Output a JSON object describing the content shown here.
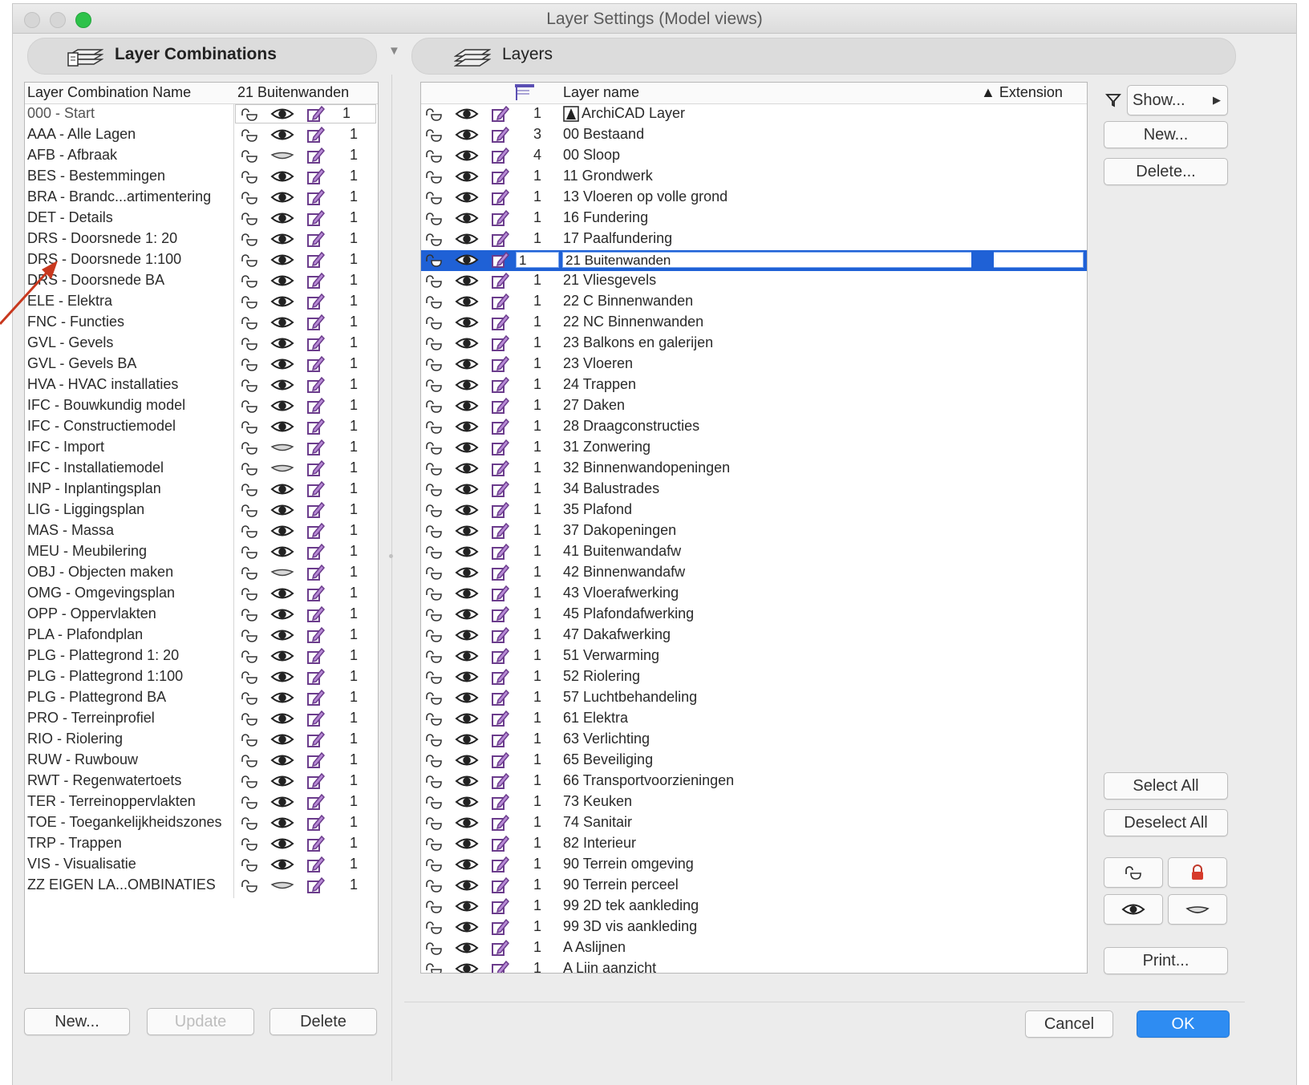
{
  "window": {
    "title": "Layer Settings (Model views)"
  },
  "combos": {
    "header": "Layer Combinations",
    "col_name": "Layer Combination Name",
    "col_selected": "21 Buitenwanden",
    "rows": [
      {
        "name": "000 - Start",
        "num": "1",
        "vis": true
      },
      {
        "name": "AAA - Alle Lagen",
        "num": "1",
        "vis": true
      },
      {
        "name": "AFB - Afbraak",
        "num": "1",
        "vis": false
      },
      {
        "name": "BES - Bestemmingen",
        "num": "1",
        "vis": true
      },
      {
        "name": "BRA - Brandc...artimentering",
        "num": "1",
        "vis": true
      },
      {
        "name": "DET - Details",
        "num": "1",
        "vis": true
      },
      {
        "name": "DRS - Doorsnede 1: 20",
        "num": "1",
        "vis": true
      },
      {
        "name": "DRS - Doorsnede 1:100",
        "num": "1",
        "vis": true
      },
      {
        "name": "DRS - Doorsnede BA",
        "num": "1",
        "vis": true
      },
      {
        "name": "ELE - Elektra",
        "num": "1",
        "vis": true
      },
      {
        "name": "FNC - Functies",
        "num": "1",
        "vis": true
      },
      {
        "name": "GVL - Gevels",
        "num": "1",
        "vis": true
      },
      {
        "name": "GVL - Gevels BA",
        "num": "1",
        "vis": true
      },
      {
        "name": "HVA - HVAC installaties",
        "num": "1",
        "vis": true
      },
      {
        "name": "IFC - Bouwkundig model",
        "num": "1",
        "vis": true
      },
      {
        "name": "IFC - Constructiemodel",
        "num": "1",
        "vis": true
      },
      {
        "name": "IFC - Import",
        "num": "1",
        "vis": false
      },
      {
        "name": "IFC - Installatiemodel",
        "num": "1",
        "vis": false
      },
      {
        "name": "INP - Inplantingsplan",
        "num": "1",
        "vis": true
      },
      {
        "name": "LIG - Liggingsplan",
        "num": "1",
        "vis": true
      },
      {
        "name": "MAS - Massa",
        "num": "1",
        "vis": true
      },
      {
        "name": "MEU - Meubilering",
        "num": "1",
        "vis": true
      },
      {
        "name": "OBJ - Objecten maken",
        "num": "1",
        "vis": false
      },
      {
        "name": "OMG - Omgevingsplan",
        "num": "1",
        "vis": true
      },
      {
        "name": "OPP - Oppervlakten",
        "num": "1",
        "vis": true
      },
      {
        "name": "PLA - Plafondplan",
        "num": "1",
        "vis": true
      },
      {
        "name": "PLG - Plattegrond 1: 20",
        "num": "1",
        "vis": true
      },
      {
        "name": "PLG - Plattegrond 1:100",
        "num": "1",
        "vis": true
      },
      {
        "name": "PLG - Plattegrond BA",
        "num": "1",
        "vis": true
      },
      {
        "name": "PRO - Terreinprofiel",
        "num": "1",
        "vis": true
      },
      {
        "name": "RIO - Riolering",
        "num": "1",
        "vis": true
      },
      {
        "name": "RUW - Ruwbouw",
        "num": "1",
        "vis": true
      },
      {
        "name": "RWT - Regenwatertoets",
        "num": "1",
        "vis": true
      },
      {
        "name": "TER - Terreinoppervlakten",
        "num": "1",
        "vis": true
      },
      {
        "name": "TOE - Toegankelijkheidszones",
        "num": "1",
        "vis": true
      },
      {
        "name": "TRP - Trappen",
        "num": "1",
        "vis": true
      },
      {
        "name": "VIS - Visualisatie",
        "num": "1",
        "vis": true
      },
      {
        "name": "ZZ EIGEN LA...OMBINATIES",
        "num": "1",
        "vis": false
      }
    ],
    "buttons": {
      "new": "New...",
      "update": "Update",
      "delete": "Delete"
    }
  },
  "layers": {
    "header": "Layers",
    "col_name": "Layer name",
    "col_ext": "▲ Extension",
    "rows": [
      {
        "num": "1",
        "name": "ArchiCAD Layer",
        "lock": true
      },
      {
        "num": "3",
        "name": "00 Bestaand"
      },
      {
        "num": "4",
        "name": "00 Sloop"
      },
      {
        "num": "1",
        "name": "11 Grondwerk"
      },
      {
        "num": "1",
        "name": "13 Vloeren op volle grond"
      },
      {
        "num": "1",
        "name": "16 Fundering"
      },
      {
        "num": "1",
        "name": "17 Paalfundering"
      },
      {
        "num": "1",
        "name": "21 Buitenwanden",
        "selected": true
      },
      {
        "num": "1",
        "name": "21 Vliesgevels"
      },
      {
        "num": "1",
        "name": "22 C Binnenwanden"
      },
      {
        "num": "1",
        "name": "22 NC Binnenwanden"
      },
      {
        "num": "1",
        "name": "23 Balkons en galerijen"
      },
      {
        "num": "1",
        "name": "23 Vloeren"
      },
      {
        "num": "1",
        "name": "24 Trappen"
      },
      {
        "num": "1",
        "name": "27 Daken"
      },
      {
        "num": "1",
        "name": "28 Draagconstructies"
      },
      {
        "num": "1",
        "name": "31 Zonwering"
      },
      {
        "num": "1",
        "name": "32 Binnenwandopeningen"
      },
      {
        "num": "1",
        "name": "34 Balustrades"
      },
      {
        "num": "1",
        "name": "35 Plafond"
      },
      {
        "num": "1",
        "name": "37 Dakopeningen"
      },
      {
        "num": "1",
        "name": "41 Buitenwandafw"
      },
      {
        "num": "1",
        "name": "42 Binnenwandafw"
      },
      {
        "num": "1",
        "name": "43 Vloerafwerking"
      },
      {
        "num": "1",
        "name": "45 Plafondafwerking"
      },
      {
        "num": "1",
        "name": "47 Dakafwerking"
      },
      {
        "num": "1",
        "name": "51 Verwarming"
      },
      {
        "num": "1",
        "name": "52 Riolering"
      },
      {
        "num": "1",
        "name": "57 Luchtbehandeling"
      },
      {
        "num": "1",
        "name": "61 Elektra"
      },
      {
        "num": "1",
        "name": "63 Verlichting"
      },
      {
        "num": "1",
        "name": "65 Beveiliging"
      },
      {
        "num": "1",
        "name": "66 Transportvoorzieningen"
      },
      {
        "num": "1",
        "name": "73 Keuken"
      },
      {
        "num": "1",
        "name": "74 Sanitair"
      },
      {
        "num": "1",
        "name": "82 Interieur"
      },
      {
        "num": "1",
        "name": "90 Terrein omgeving"
      },
      {
        "num": "1",
        "name": "90 Terrein perceel"
      },
      {
        "num": "1",
        "name": "99 2D tek aankleding"
      },
      {
        "num": "1",
        "name": "99 3D vis aankleding"
      },
      {
        "num": "1",
        "name": "A Aslijnen"
      },
      {
        "num": "1",
        "name": "A Lijn aanzicht"
      }
    ]
  },
  "side": {
    "show": "Show...",
    "new": "New...",
    "delete": "Delete...",
    "select_all": "Select All",
    "deselect_all": "Deselect All",
    "print": "Print..."
  },
  "footer": {
    "cancel": "Cancel",
    "ok": "OK"
  },
  "colors": {
    "selection": "#1f61d6",
    "ok_button": "#2e8cf2",
    "annotation_arrow": "#c8381e"
  }
}
